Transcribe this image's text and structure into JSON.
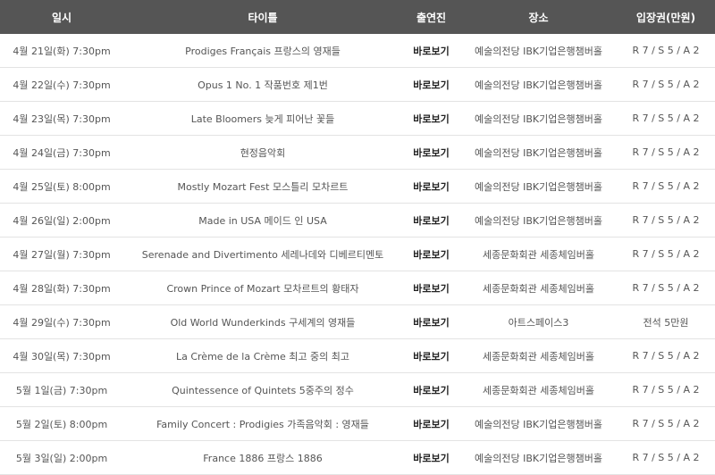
{
  "table": {
    "headers": [
      "일시",
      "타이틀",
      "출연진",
      "장소",
      "입장권(만원)"
    ],
    "rows": [
      {
        "date": "4월 21일(화) 7:30pm",
        "title": "Prodiges Français 프랑스의 영재들",
        "performers": "바로보기",
        "venue": "예술의전당 IBK기업은행챔버홀",
        "price": "R 7 / S 5 / A 2"
      },
      {
        "date": "4월 22일(수) 7:30pm",
        "title": "Opus 1 No. 1 작품번호 제1번",
        "performers": "바로보기",
        "venue": "예술의전당 IBK기업은행챔버홀",
        "price": "R 7 / S 5 / A 2"
      },
      {
        "date": "4월 23일(목) 7:30pm",
        "title": "Late Bloomers 늦게 피어난 꽃들",
        "performers": "바로보기",
        "venue": "예술의전당 IBK기업은행챔버홀",
        "price": "R 7 / S 5 / A 2"
      },
      {
        "date": "4월 24일(금) 7:30pm",
        "title": "현정음악회",
        "performers": "바로보기",
        "venue": "예술의전당 IBK기업은행챔버홀",
        "price": "R 7 / S 5 / A 2"
      },
      {
        "date": "4월 25일(토) 8:00pm",
        "title": "Mostly Mozart Fest 모스틀리 모차르트",
        "performers": "바로보기",
        "venue": "예술의전당 IBK기업은행챔버홀",
        "price": "R 7 / S 5 / A 2"
      },
      {
        "date": "4월 26일(일) 2:00pm",
        "title": "Made in USA 메이드 인 USA",
        "performers": "바로보기",
        "venue": "예술의전당 IBK기업은행챔버홀",
        "price": "R 7 / S 5 / A 2"
      },
      {
        "date": "4월 27일(월) 7:30pm",
        "title": "Serenade and Divertimento 세레나데와 디베르티멘토",
        "performers": "바로보기",
        "venue": "세종문화회관 세종체임버홀",
        "price": "R 7 / S 5 / A 2"
      },
      {
        "date": "4월 28일(화) 7:30pm",
        "title": "Crown Prince of Mozart 모차르트의 황태자",
        "performers": "바로보기",
        "venue": "세종문화회관 세종체임버홀",
        "price": "R 7 / S 5 / A 2"
      },
      {
        "date": "4월 29일(수) 7:30pm",
        "title": "Old World Wunderkinds 구세계의 영재들",
        "performers": "바로보기",
        "venue": "아트스페이스3",
        "price": "전석 5만원"
      },
      {
        "date": "4월 30일(목) 7:30pm",
        "title": "La Crème de la Crème 최고 중의 최고",
        "performers": "바로보기",
        "venue": "세종문화회관 세종체임버홀",
        "price": "R 7 / S 5 / A 2"
      },
      {
        "date": "5월 1일(금) 7:30pm",
        "title": "Quintessence of Quintets 5중주의 정수",
        "performers": "바로보기",
        "venue": "세종문화회관 세종체임버홀",
        "price": "R 7 / S 5 / A 2"
      },
      {
        "date": "5월 2일(토) 8:00pm",
        "title": "Family Concert : Prodigies 가족음악회 : 영재들",
        "performers": "바로보기",
        "venue": "예술의전당 IBK기업은행챔버홀",
        "price": "R 7 / S 5 / A 2"
      },
      {
        "date": "5월 3일(일) 2:00pm",
        "title": "France 1886 프랑스 1886",
        "performers": "바로보기",
        "venue": "예술의전당 IBK기업은행챔버홀",
        "price": "R 7 / S 5 / A 2"
      }
    ]
  }
}
